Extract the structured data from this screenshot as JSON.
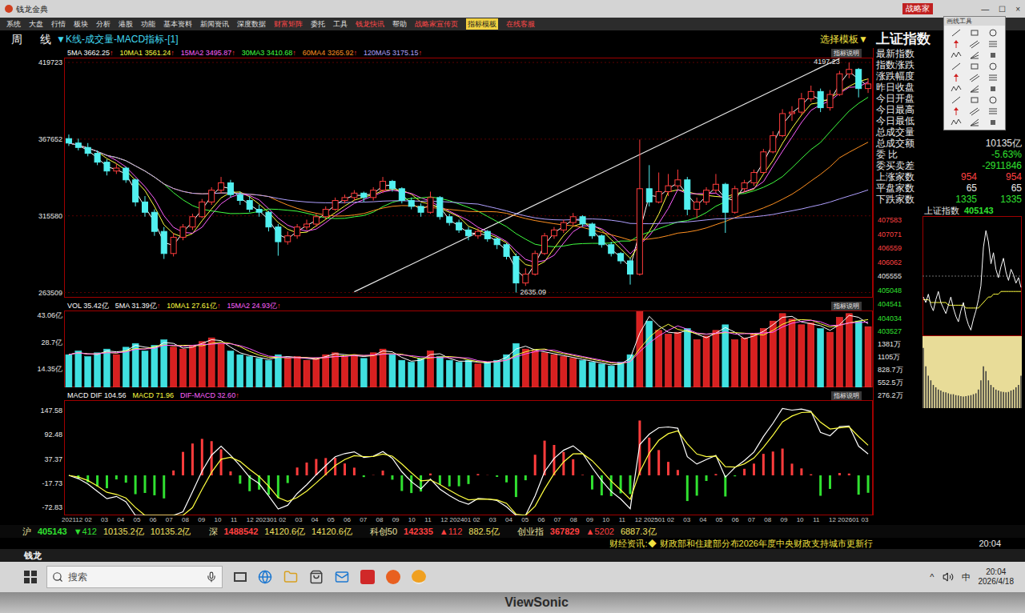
{
  "window": {
    "title": "钱龙金典",
    "badge": "战略家",
    "controls": [
      "—",
      "☐",
      "×"
    ]
  },
  "menu": [
    {
      "label": "系统",
      "color": "#e0e0e0",
      "highlight": false
    },
    {
      "label": "大盘",
      "color": "#e0e0e0",
      "highlight": false
    },
    {
      "label": "行情",
      "color": "#e0e0e0",
      "highlight": false
    },
    {
      "label": "板块",
      "color": "#e0e0e0",
      "highlight": false
    },
    {
      "label": "分析",
      "color": "#e0e0e0",
      "highlight": false
    },
    {
      "label": "港股",
      "color": "#e0e0e0",
      "highlight": false
    },
    {
      "label": "功能",
      "color": "#e0e0e0",
      "highlight": false
    },
    {
      "label": "基本资料",
      "color": "#e0e0e0",
      "highlight": false
    },
    {
      "label": "新闻资讯",
      "color": "#e0e0e0",
      "highlight": false
    },
    {
      "label": "深度数据",
      "color": "#e0e0e0",
      "highlight": false
    },
    {
      "label": "财富矩阵",
      "color": "#ff4848",
      "highlight": false
    },
    {
      "label": "委托",
      "color": "#e0e0e0",
      "highlight": false
    },
    {
      "label": "工具",
      "color": "#e0e0e0",
      "highlight": false
    },
    {
      "label": "钱龙快讯",
      "color": "#ff4848",
      "highlight": false
    },
    {
      "label": "帮助",
      "color": "#e0e0e0",
      "highlight": false
    },
    {
      "label": "战略家宣传页",
      "color": "#ff4848",
      "highlight": false
    },
    {
      "label": "指标模板",
      "color": "#202020",
      "highlight": true
    },
    {
      "label": "在线客服",
      "color": "#ff4848",
      "highlight": false
    }
  ],
  "header": {
    "period": [
      "周",
      "线"
    ],
    "indicator": "▼K线-成交量-MACD指标-[1]",
    "template": "选择模板▼",
    "symbol": "上证指数"
  },
  "price_panel": {
    "legend": [
      {
        "label": "5MA",
        "value": "3662.25",
        "arrow": "↑",
        "color": "#ffffff"
      },
      {
        "label": "10MA1",
        "value": "3561.24",
        "arrow": "↑",
        "color": "#ffff40"
      },
      {
        "label": "15MA2",
        "value": "3495.87",
        "arrow": "↑",
        "color": "#ff60ff"
      },
      {
        "label": "30MA3",
        "value": "3410.68",
        "arrow": "↑",
        "color": "#40ff40"
      },
      {
        "label": "60MA4",
        "value": "3265.92",
        "arrow": "↑",
        "color": "#ff9020"
      },
      {
        "label": "120MA5",
        "value": "3175.15",
        "arrow": "↑",
        "color": "#b0a0ff"
      }
    ],
    "help": "指标说明",
    "axis": [
      "419723",
      "367652",
      "315580",
      "263509"
    ],
    "low_label": "2635.09",
    "peak_label": "4197.23",
    "trendline": {
      "from": [
        30,
        2640
      ],
      "to": [
        81,
        4225
      ]
    },
    "candles": [
      [
        3680,
        3708,
        3630,
        3650
      ],
      [
        3650,
        3680,
        3600,
        3620
      ],
      [
        3620,
        3650,
        3560,
        3580
      ],
      [
        3580,
        3600,
        3500,
        3520
      ],
      [
        3520,
        3540,
        3430,
        3460
      ],
      [
        3460,
        3510,
        3440,
        3480
      ],
      [
        3480,
        3490,
        3380,
        3400
      ],
      [
        3400,
        3410,
        3220,
        3250
      ],
      [
        3250,
        3290,
        3150,
        3180
      ],
      [
        3180,
        3200,
        3020,
        3050
      ],
      [
        3050,
        3080,
        2863,
        2900
      ],
      [
        2900,
        3040,
        2880,
        3010
      ],
      [
        3010,
        3100,
        2990,
        3080
      ],
      [
        3080,
        3170,
        3060,
        3150
      ],
      [
        3150,
        3270,
        3140,
        3250
      ],
      [
        3250,
        3350,
        3230,
        3330
      ],
      [
        3330,
        3420,
        3310,
        3380
      ],
      [
        3380,
        3400,
        3280,
        3300
      ],
      [
        3300,
        3320,
        3230,
        3260
      ],
      [
        3260,
        3290,
        3180,
        3200
      ],
      [
        3200,
        3230,
        3150,
        3180
      ],
      [
        3180,
        3190,
        3050,
        3080
      ],
      [
        3080,
        3100,
        2885,
        2980
      ],
      [
        2980,
        3050,
        2960,
        3020
      ],
      [
        3020,
        3100,
        3000,
        3080
      ],
      [
        3080,
        3130,
        3060,
        3100
      ],
      [
        3100,
        3170,
        3080,
        3150
      ],
      [
        3150,
        3220,
        3130,
        3200
      ],
      [
        3200,
        3280,
        3190,
        3260
      ],
      [
        3260,
        3300,
        3240,
        3280
      ],
      [
        3280,
        3330,
        3260,
        3310
      ],
      [
        3310,
        3320,
        3250,
        3280
      ],
      [
        3280,
        3350,
        3260,
        3330
      ],
      [
        3330,
        3420,
        3310,
        3390
      ],
      [
        3390,
        3400,
        3320,
        3340
      ],
      [
        3340,
        3350,
        3240,
        3260
      ],
      [
        3260,
        3280,
        3200,
        3220
      ],
      [
        3220,
        3240,
        3150,
        3180
      ],
      [
        3180,
        3320,
        3170,
        3280
      ],
      [
        3280,
        3290,
        3130,
        3150
      ],
      [
        3150,
        3170,
        3090,
        3110
      ],
      [
        3110,
        3130,
        3040,
        3060
      ],
      [
        3060,
        3080,
        2990,
        3020
      ],
      [
        3020,
        3070,
        3000,
        3050
      ],
      [
        3050,
        3060,
        2980,
        3000
      ],
      [
        3000,
        3010,
        2930,
        2960
      ],
      [
        2960,
        2970,
        2860,
        2880
      ],
      [
        2880,
        2900,
        2635.09,
        2700
      ],
      [
        2700,
        2800,
        2680,
        2760
      ],
      [
        2760,
        2920,
        2750,
        2900
      ],
      [
        2900,
        3040,
        2890,
        3020
      ],
      [
        3020,
        3080,
        3000,
        3060
      ],
      [
        3060,
        3130,
        3040,
        3110
      ],
      [
        3110,
        3175,
        3090,
        3150
      ],
      [
        3150,
        3160,
        3080,
        3100
      ],
      [
        3100,
        3110,
        3000,
        3020
      ],
      [
        3020,
        3030,
        2940,
        2960
      ],
      [
        2960,
        2980,
        2880,
        2900
      ],
      [
        2900,
        2910,
        2830,
        2850
      ],
      [
        2850,
        2870,
        2689,
        2760
      ],
      [
        2760,
        3674,
        2750,
        3340
      ],
      [
        3340,
        3500,
        3220,
        3250
      ],
      [
        3250,
        3450,
        3240,
        3320
      ],
      [
        3320,
        3440,
        3290,
        3360
      ],
      [
        3360,
        3470,
        3340,
        3400
      ],
      [
        3400,
        3420,
        3160,
        3200
      ],
      [
        3200,
        3280,
        3140,
        3250
      ],
      [
        3250,
        3350,
        3230,
        3330
      ],
      [
        3330,
        3440,
        3310,
        3370
      ],
      [
        3370,
        3380,
        3040,
        3180
      ],
      [
        3180,
        3360,
        3170,
        3340
      ],
      [
        3340,
        3400,
        3320,
        3380
      ],
      [
        3380,
        3470,
        3360,
        3450
      ],
      [
        3450,
        3610,
        3440,
        3590
      ],
      [
        3590,
        3730,
        3580,
        3700
      ],
      [
        3700,
        3880,
        3690,
        3850
      ],
      [
        3850,
        3900,
        3800,
        3860
      ],
      [
        3860,
        3990,
        3840,
        3950
      ],
      [
        3950,
        4040,
        3930,
        4000
      ],
      [
        4000,
        4020,
        3860,
        3890
      ],
      [
        3890,
        4010,
        3870,
        3980
      ],
      [
        3980,
        4140,
        3970,
        4120
      ],
      [
        4120,
        4197.23,
        4090,
        4150
      ],
      [
        4150,
        4160,
        3960,
        4020
      ],
      [
        4020,
        4090,
        3990,
        4051.43
      ]
    ]
  },
  "volume_panel": {
    "legend": [
      {
        "label": "VOL",
        "value": "35.42亿",
        "color": "#ffffff"
      },
      {
        "label": "5MA",
        "value": "31.39亿",
        "arrow": "↑",
        "color": "#ffffff"
      },
      {
        "label": "10MA1",
        "value": "27.61亿",
        "arrow": "↑",
        "color": "#ffff40"
      },
      {
        "label": "15MA2",
        "value": "24.93亿",
        "arrow": "↑",
        "color": "#ff60ff"
      }
    ],
    "help": "指标说明",
    "axis": [
      "43.06亿",
      "28.7亿",
      "14.35亿"
    ],
    "values": [
      22,
      24,
      21,
      23,
      25,
      22,
      26,
      28,
      24,
      27,
      30,
      26,
      25,
      27,
      29,
      31,
      28,
      24,
      22,
      21,
      20,
      19,
      22,
      20,
      21,
      19,
      20,
      22,
      23,
      21,
      22,
      20,
      23,
      25,
      22,
      19,
      18,
      20,
      24,
      21,
      19,
      18,
      19,
      17,
      18,
      19,
      22,
      28,
      25,
      24,
      23,
      22,
      21,
      20,
      19,
      18,
      17,
      16,
      18,
      22,
      45,
      40,
      35,
      33,
      34,
      36,
      30,
      32,
      35,
      38,
      30,
      31,
      33,
      36,
      40,
      44,
      41,
      38,
      39,
      36,
      34,
      42,
      44,
      40,
      37
    ]
  },
  "macd_panel": {
    "legend": [
      {
        "label": "MACD DIF",
        "value": "104.56",
        "color": "#ffffff"
      },
      {
        "label": "MACD",
        "value": "71.96",
        "color": "#ffff40"
      },
      {
        "label": "DIF-MACD",
        "value": "32.60",
        "arrow": "↑",
        "color": "#ff60ff"
      }
    ],
    "help": "指标说明",
    "axis": [
      "147.58",
      "92.48",
      "37.37",
      "-17.73",
      "-72.83"
    ]
  },
  "date_axis": [
    "202112",
    "02",
    "03",
    "04",
    "05",
    "06",
    "07",
    "08",
    "09",
    "10",
    "11",
    "12",
    "202301",
    "02",
    "03",
    "04",
    "05",
    "06",
    "07",
    "08",
    "09",
    "10",
    "11",
    "12",
    "202401",
    "02",
    "03",
    "04",
    "05",
    "06",
    "07",
    "08",
    "09",
    "10",
    "11",
    "12",
    "202501",
    "02",
    "03",
    "04",
    "05",
    "06",
    "07",
    "08",
    "09",
    "10",
    "11",
    "12",
    "202601",
    "03"
  ],
  "quote": {
    "rows": [
      {
        "label": "最新指数"
      },
      {
        "label": "指数涨跌"
      },
      {
        "label": "涨跌幅度"
      },
      {
        "label": "昨日收盘"
      },
      {
        "label": "今日开盘"
      },
      {
        "label": "今日最高"
      },
      {
        "label": "今日最低"
      },
      {
        "label": "总成交量"
      },
      {
        "label": "总成交额",
        "values": [
          "10135亿"
        ],
        "color": "#e8e8e8"
      },
      {
        "label": "委 比",
        "values": [
          "-5.63%"
        ],
        "color": "#30e030"
      },
      {
        "label": "委买卖差",
        "values": [
          "-2911846"
        ],
        "color": "#30e030"
      },
      {
        "label": "上涨家数",
        "values": [
          "954",
          "954"
        ],
        "color": "#ff4040"
      },
      {
        "label": "平盘家数",
        "values": [
          "65",
          "65"
        ],
        "color": "#e8e8e8"
      },
      {
        "label": "下跌家数",
        "values": [
          "1335",
          "1335"
        ],
        "color": "#30e030"
      }
    ]
  },
  "mini_chart": {
    "title": "上证指数",
    "value": "405143",
    "value_color": "#30e030",
    "price_axis": [
      {
        "text": "407583",
        "color": "#ff4040"
      },
      {
        "text": "407071",
        "color": "#ff4040"
      },
      {
        "text": "406559",
        "color": "#ff4040"
      },
      {
        "text": "406062",
        "color": "#ff4040"
      },
      {
        "text": "405555",
        "color": "#e8e8e8"
      },
      {
        "text": "405048",
        "color": "#30e030"
      },
      {
        "text": "404541",
        "color": "#30e030"
      },
      {
        "text": "404034",
        "color": "#30e030"
      },
      {
        "text": "403527",
        "color": "#30e030"
      }
    ],
    "volume_axis": [
      "1381万",
      "1105万",
      "828.7万",
      "552.5万",
      "276.2万"
    ],
    "prices": [
      4048,
      4046,
      4049,
      4045,
      4043,
      4047,
      4050,
      4046,
      4044,
      4042,
      4045,
      4048,
      4044,
      4041,
      4039,
      4043,
      4046,
      4041,
      4038,
      4036,
      4040,
      4043,
      4047,
      4052,
      4066,
      4072,
      4068,
      4060,
      4064,
      4058,
      4055,
      4059,
      4062,
      4057,
      4054,
      4058,
      4056,
      4053,
      4055,
      4051.43
    ],
    "average": [
      4047,
      4047,
      4047,
      4046,
      4046,
      4046,
      4046,
      4046,
      4046,
      4046,
      4045,
      4045,
      4045,
      4045,
      4045,
      4045,
      4045,
      4044,
      4044,
      4044,
      4044,
      4044,
      4044,
      4045,
      4046,
      4047,
      4048,
      4048,
      4049,
      4049,
      4049,
      4050,
      4050,
      4050,
      4050,
      4050,
      4050,
      4050,
      4050,
      4050
    ],
    "volumes": [
      1300,
      900,
      700,
      600,
      500,
      450,
      400,
      380,
      350,
      340,
      320,
      300,
      300,
      280,
      270,
      260,
      250,
      260,
      270,
      280,
      300,
      320,
      400,
      600,
      900,
      800,
      600,
      500,
      450,
      400,
      380,
      360,
      350,
      340,
      350,
      380,
      400,
      450,
      500,
      700
    ]
  },
  "palette": {
    "title": "画线工具"
  },
  "status": [
    {
      "name": "沪",
      "value": "405143",
      "change": "▼412",
      "amounts": [
        "10135.2亿",
        "10135.2亿"
      ],
      "color": "#30e030"
    },
    {
      "name": "深",
      "value": "1488542",
      "amounts": [
        "14120.6亿",
        "14120.6亿"
      ],
      "color": "#ff4040"
    },
    {
      "name": "科创50",
      "value": "142335",
      "change": "▲112",
      "amounts": [
        "882.5亿"
      ],
      "color": "#ff4040"
    },
    {
      "name": "创业指",
      "value": "367829",
      "change": "▲5202",
      "amounts": [
        "6887.3亿"
      ],
      "color": "#ff4040"
    }
  ],
  "news": {
    "label": "财经资讯:◆",
    "text": "财政部和住建部分布2026年度中央财政支持城市更新行",
    "clock": "20:04"
  },
  "app_tab": "钱龙",
  "taskbar": {
    "search": "搜索",
    "tray": {
      "chevron": "^",
      "ime": "中",
      "time": "20:04",
      "date": "2026/4/18"
    }
  },
  "bezel": {
    "brand": "ViewSonic"
  }
}
